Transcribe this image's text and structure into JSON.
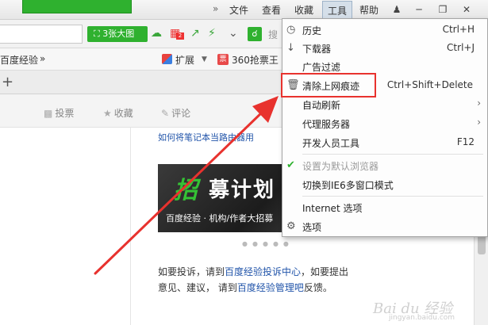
{
  "menubar": {
    "items": [
      "文件",
      "查看",
      "收藏",
      "工具",
      "帮助"
    ],
    "active_index": 3,
    "more_arrow": "»",
    "window_buttons": [
      "shirt-icon",
      "minimize-icon",
      "restore-icon",
      "close-icon"
    ]
  },
  "toolbar": {
    "big_images_label": "3张大图",
    "badge": "2",
    "search_hint": "搜",
    "icons": [
      "expand-icon",
      "cloud-icon",
      "share-icon",
      "bolt-icon",
      "chevron-down-icon",
      "search-icon"
    ]
  },
  "bookmarks": {
    "first_item": "百度经验",
    "more": "»",
    "extension_label": "扩展",
    "item_360": "360抢票王"
  },
  "page": {
    "actions": [
      {
        "icon": "chart-icon",
        "label": "投票"
      },
      {
        "icon": "star-icon",
        "label": "收藏"
      },
      {
        "icon": "pencil-icon",
        "label": "评论"
      }
    ],
    "top_link": "如何将笔记本当路由器用",
    "banner_char": "招",
    "banner_title": "募计划",
    "banner_sub": "百度经验 · 机构/作者大招募",
    "footer": {
      "t1": "如要投诉，请到",
      "l1": "百度经验投诉中心",
      "t2": "，如要提出意见、建议， 请到",
      "l2": "百度经验管理吧",
      "t3": "反馈。"
    }
  },
  "tools_menu": {
    "items": [
      {
        "label": "历史",
        "shortcut": "Ctrl+H",
        "icon": "clock-icon"
      },
      {
        "label": "下载器",
        "shortcut": "Ctrl+J",
        "icon": "download-icon"
      },
      {
        "label": "广告过滤",
        "shortcut": "",
        "icon": ""
      },
      {
        "label": "清除上网痕迹",
        "shortcut": "Ctrl+Shift+Delete",
        "icon": "trash-icon"
      },
      {
        "label": "自动刷新",
        "shortcut": "",
        "icon": "",
        "submenu": "›"
      },
      {
        "label": "代理服务器",
        "shortcut": "",
        "icon": "",
        "submenu": "›"
      },
      {
        "label": "开发人员工具",
        "shortcut": "F12",
        "icon": ""
      },
      {
        "label": "设置为默认浏览器",
        "shortcut": "",
        "icon": "check-icon",
        "disabled": true
      },
      {
        "label": "切换到IE6多窗口模式",
        "shortcut": "",
        "icon": ""
      },
      {
        "label": "Internet 选项",
        "shortcut": "",
        "icon": ""
      },
      {
        "label": "选项",
        "shortcut": "",
        "icon": "gear-icon"
      }
    ]
  },
  "watermark": {
    "brand": "Bai du 经验",
    "url": "jingyan.baidu.com"
  },
  "colors": {
    "accent_green": "#2fb12f",
    "highlight_red": "#e8322e",
    "link_blue": "#2255aa"
  }
}
